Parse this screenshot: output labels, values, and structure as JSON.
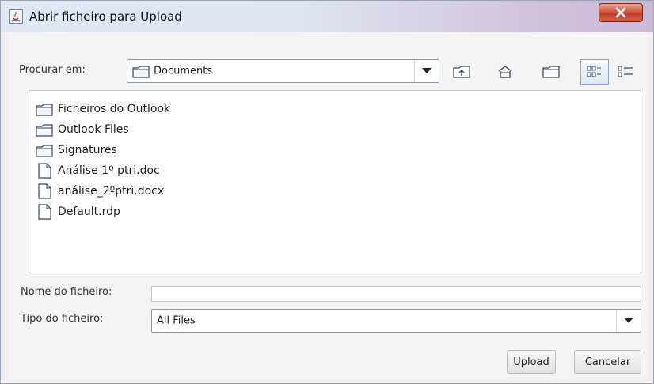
{
  "window": {
    "title": "Abrir ficheiro para Upload"
  },
  "lookin": {
    "label": "Procurar em:",
    "value": "Documents"
  },
  "toolbar": {
    "icons": [
      "up-folder-icon",
      "home-icon",
      "new-folder-icon",
      "list-view-icon",
      "details-view-icon"
    ]
  },
  "files": [
    {
      "name": "Ficheiros do Outlook",
      "type": "folder"
    },
    {
      "name": "Outlook Files",
      "type": "folder"
    },
    {
      "name": "Signatures",
      "type": "folder"
    },
    {
      "name": "Análise 1º ptri.doc",
      "type": "file"
    },
    {
      "name": "análise_2ºptri.docx",
      "type": "file"
    },
    {
      "name": "Default.rdp",
      "type": "file"
    }
  ],
  "filename": {
    "label": "Nome do ficheiro:",
    "value": ""
  },
  "filetype": {
    "label": "Tipo do ficheiro:",
    "value": "All Files"
  },
  "buttons": {
    "upload": "Upload",
    "cancel": "Cancelar"
  },
  "colors": {
    "close": "#c94a30",
    "titlebar": "#dde5ef"
  }
}
